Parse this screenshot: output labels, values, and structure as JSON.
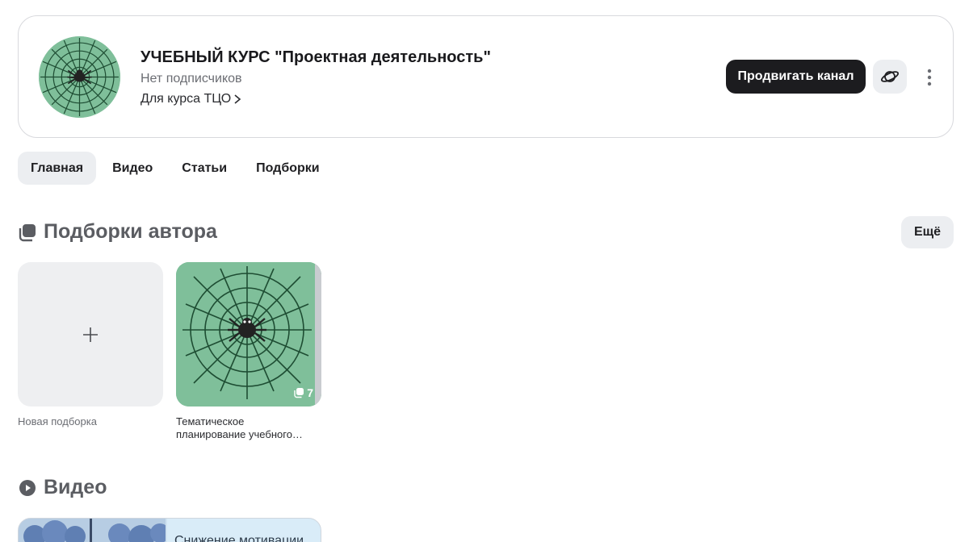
{
  "channel": {
    "title": "УЧЕБНЫЙ КУРС \"Проектная деятельность\"",
    "subscribers": "Нет подписчиков",
    "description": "Для курса ТЦО",
    "promote_label": "Продвигать канал"
  },
  "tabs": [
    {
      "label": "Главная",
      "active": true
    },
    {
      "label": "Видео",
      "active": false
    },
    {
      "label": "Статьи",
      "active": false
    },
    {
      "label": "Подборки",
      "active": false
    }
  ],
  "collections_section": {
    "title": "Подборки автора",
    "more_label": "Ещё",
    "new_label": "Новая подборка",
    "items": [
      {
        "caption_line1": "Тематическое",
        "caption_line2": "планирование учебного…",
        "count": "7"
      }
    ]
  },
  "videos_section": {
    "title": "Видео",
    "first_video_title_peek": "Снижение мотивации"
  },
  "colors": {
    "primary_button": "#1c1c1f",
    "chip_bg": "#eceef1",
    "cover_green": "#7fbf9a"
  }
}
